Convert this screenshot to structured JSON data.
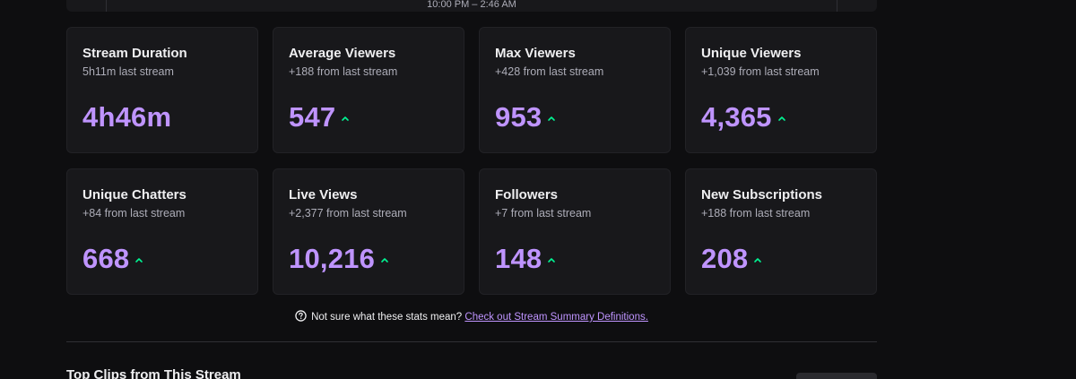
{
  "header": {
    "time_range": "10:00 PM – 2:46 AM"
  },
  "colors": {
    "accent": "#bf94ff",
    "trend_up": "#00f593"
  },
  "stats": [
    {
      "title": "Stream Duration",
      "sub": "5h11m last stream",
      "value": "4h46m",
      "trend": "none"
    },
    {
      "title": "Average Viewers",
      "sub": "+188 from last stream",
      "value": "547",
      "trend": "up"
    },
    {
      "title": "Max Viewers",
      "sub": "+428 from last stream",
      "value": "953",
      "trend": "up"
    },
    {
      "title": "Unique Viewers",
      "sub": "+1,039 from last stream",
      "value": "4,365",
      "trend": "up"
    },
    {
      "title": "Unique Chatters",
      "sub": "+84 from last stream",
      "value": "668",
      "trend": "up"
    },
    {
      "title": "Live Views",
      "sub": "+2,377 from last stream",
      "value": "10,216",
      "trend": "up"
    },
    {
      "title": "Followers",
      "sub": "+7 from last stream",
      "value": "148",
      "trend": "up"
    },
    {
      "title": "New Subscriptions",
      "sub": "+188 from last stream",
      "value": "208",
      "trend": "up"
    }
  ],
  "help": {
    "text": "Not sure what these stats mean?",
    "link": "Check out Stream Summary Definitions."
  },
  "clips": {
    "title": "Top Clips from This Stream"
  }
}
